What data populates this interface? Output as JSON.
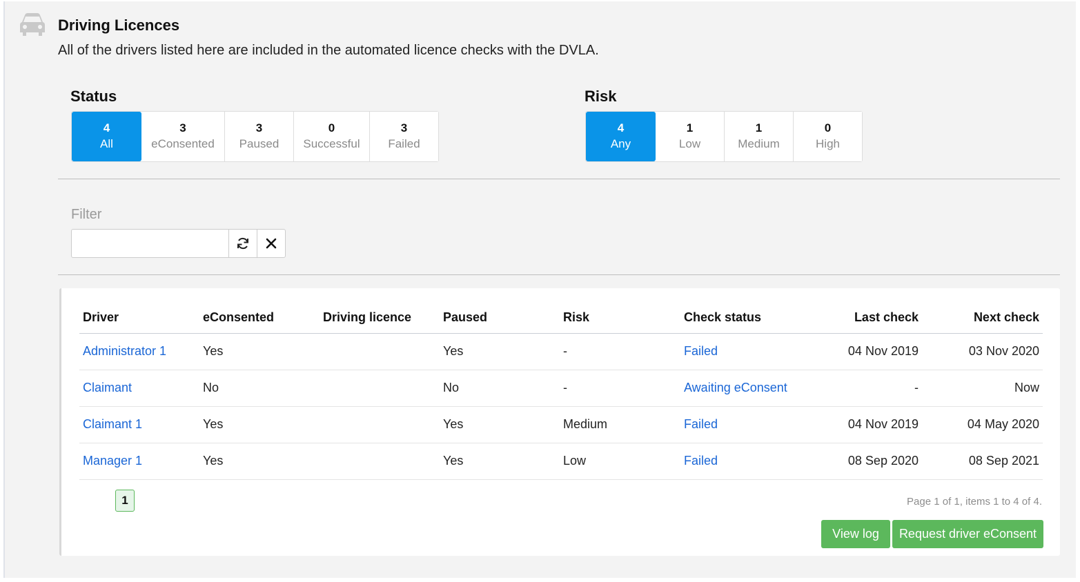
{
  "header": {
    "icon": "car-icon",
    "title": "Driving Licences",
    "description": "All of the drivers listed here are included in the automated licence checks with the DVLA."
  },
  "status": {
    "label": "Status",
    "options": [
      {
        "count": "4",
        "label": "All",
        "active": true
      },
      {
        "count": "3",
        "label": "eConsented",
        "active": false
      },
      {
        "count": "3",
        "label": "Paused",
        "active": false
      },
      {
        "count": "0",
        "label": "Successful",
        "active": false
      },
      {
        "count": "3",
        "label": "Failed",
        "active": false
      }
    ]
  },
  "risk": {
    "label": "Risk",
    "options": [
      {
        "count": "4",
        "label": "Any",
        "active": true
      },
      {
        "count": "1",
        "label": "Low",
        "active": false
      },
      {
        "count": "1",
        "label": "Medium",
        "active": false
      },
      {
        "count": "0",
        "label": "High",
        "active": false
      }
    ]
  },
  "filter": {
    "label": "Filter",
    "value": "",
    "placeholder": ""
  },
  "table": {
    "columns": [
      "Driver",
      "eConsented",
      "Driving licence",
      "Paused",
      "Risk",
      "Check status",
      "Last check",
      "Next check"
    ],
    "rows": [
      [
        "Administrator 1",
        "Yes",
        "",
        "Yes",
        "-",
        "Failed",
        "04 Nov 2019",
        "03 Nov 2020"
      ],
      [
        "Claimant",
        "No",
        "",
        "No",
        "-",
        "Awaiting eConsent",
        "-",
        "Now"
      ],
      [
        "Claimant 1",
        "Yes",
        "",
        "Yes",
        "Medium",
        "Failed",
        "04 Nov 2019",
        "04 May 2020"
      ],
      [
        "Manager 1",
        "Yes",
        "",
        "Yes",
        "Low",
        "Failed",
        "08 Sep 2020",
        "08 Sep 2021"
      ]
    ]
  },
  "pagination": {
    "current": "1",
    "info": "Page 1 of 1, items 1 to 4 of 4."
  },
  "actions": {
    "view_log": "View log",
    "request_econsent": "Request driver eConsent"
  },
  "colors": {
    "accent": "#0a94e8",
    "link": "#1a66d6",
    "success": "#5cb85c"
  }
}
